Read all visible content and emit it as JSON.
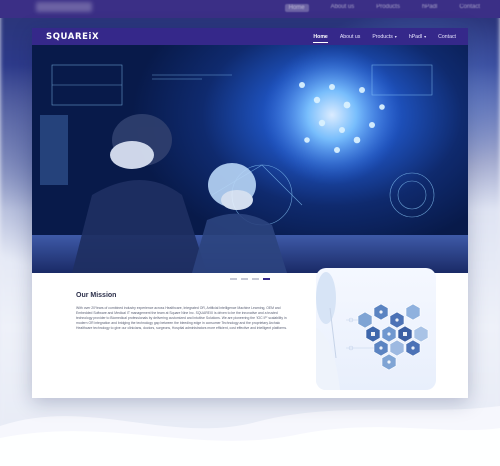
{
  "brand": {
    "logo": "SQUAREiX"
  },
  "nav": {
    "items": [
      {
        "label": "Home",
        "active": true,
        "dropdown": false
      },
      {
        "label": "About us",
        "active": false,
        "dropdown": false
      },
      {
        "label": "Products",
        "active": false,
        "dropdown": true
      },
      {
        "label": "hPadl",
        "active": false,
        "dropdown": true
      },
      {
        "label": "Contact",
        "active": false,
        "dropdown": false
      }
    ]
  },
  "hero": {
    "slide_count": 4,
    "active_slide": 4
  },
  "mission": {
    "title": "Our Mission",
    "text": "With over 20Years of combined industry experience across Healthcare, Integrated OR, Artificial Intelligence Machine Learning, OEM and Embedded Software and Medical IT management the team at Square Nine Inc. SQUAREIX is driven to be the innovative and a trusted technology provider to Biomedical professionals by delivering customized and intuitive Solutions. We are pioneering the 'IOC IP' scalability in modern OR integration and bridging the technology gap between the bleeding edge in consumer Technology and the proprietary Archaic Healthcare technology to give our clinicians, doctors, surgeons, Hospital administrators more efficient, cost effective and intelligent platforms."
  },
  "colors": {
    "brand": "#35288a",
    "accent": "#4c8bff"
  }
}
